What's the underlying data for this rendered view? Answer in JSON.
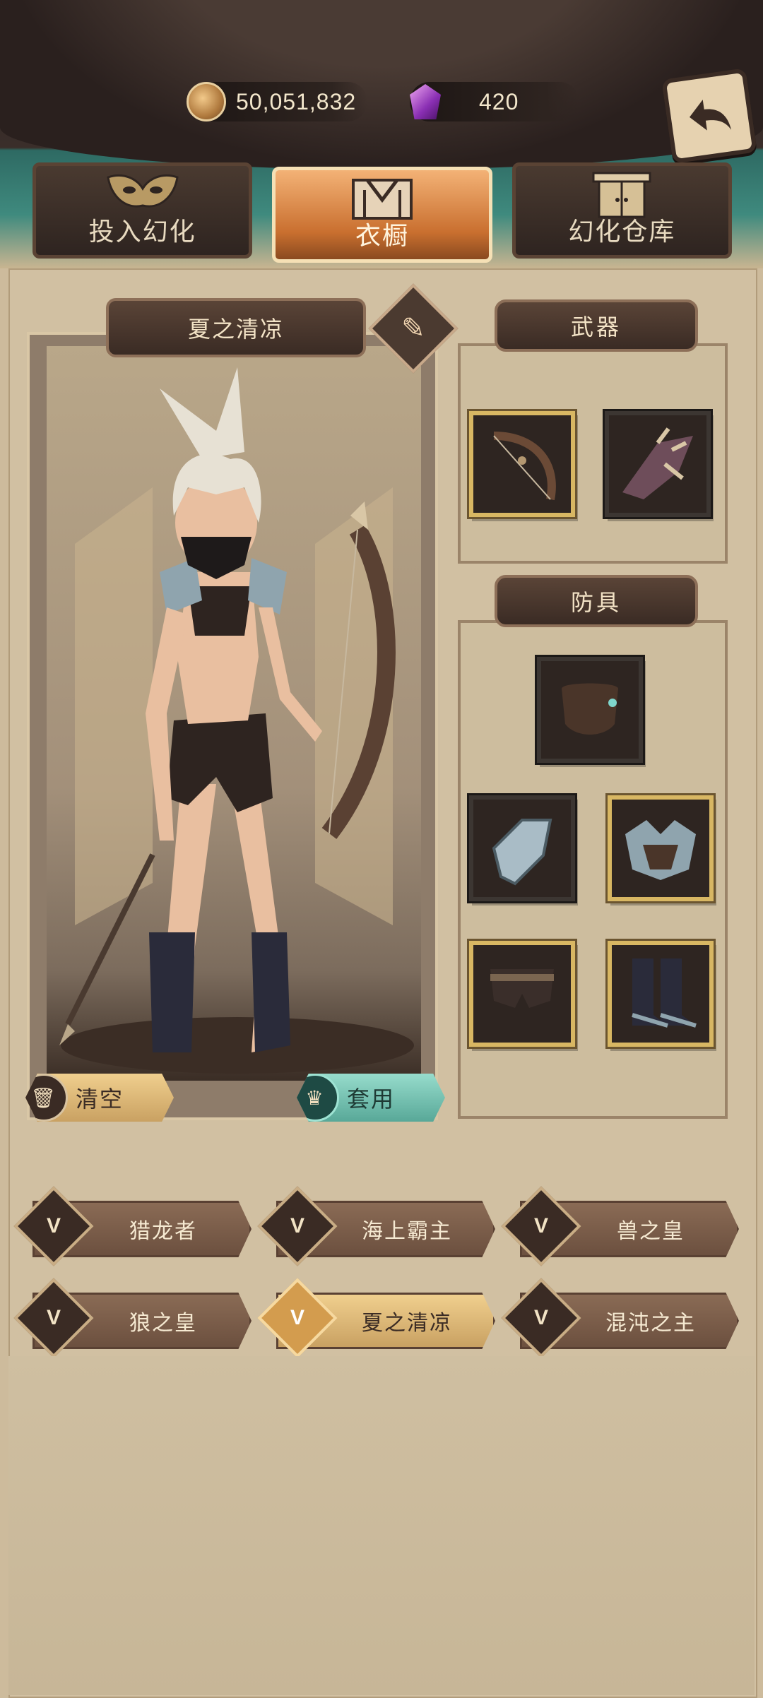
{
  "currency": {
    "coins": "50,051,832",
    "gems": "420",
    "coin_icon": "coin-icon",
    "gem_icon": "gem-icon"
  },
  "tabs": [
    {
      "label": "投入幻化",
      "icon": "mask-icon",
      "active": false
    },
    {
      "label": "衣橱",
      "icon": "wardrobe-icon",
      "active": true
    },
    {
      "label": "幻化仓库",
      "icon": "cabinet-icon",
      "active": false
    }
  ],
  "preview": {
    "outfit_name": "夏之清凉",
    "clear_label": "清空",
    "apply_label": "套用"
  },
  "weapon_section": {
    "title": "武器",
    "slots": [
      "bow-icon",
      "claw-gauntlet-icon"
    ]
  },
  "armor_section": {
    "title": "防具",
    "slots": [
      "mask-helmet-icon",
      "bracer-icon",
      "shoulder-armor-icon",
      "belt-shorts-icon",
      "boots-icon"
    ]
  },
  "skins": [
    {
      "label": "猎龙者",
      "active": false
    },
    {
      "label": "海上霸主",
      "active": false
    },
    {
      "label": "兽之皇",
      "active": false
    },
    {
      "label": "狼之皇",
      "active": false
    },
    {
      "label": "夏之清凉",
      "active": true
    },
    {
      "label": "混沌之主",
      "active": false
    }
  ],
  "colors": {
    "accent_gold": "#d8b763",
    "active_tab": "#c96f2f",
    "apply_teal": "#58a898",
    "panel_bg": "#cdbd9e"
  }
}
